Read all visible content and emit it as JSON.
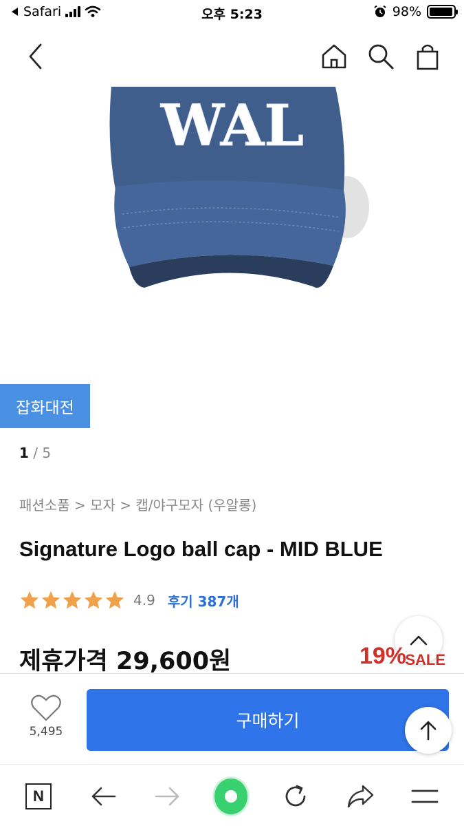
{
  "status_bar": {
    "carrier": "Safari",
    "time": "오후 5:23",
    "battery": "98%",
    "battery_level": 0.98
  },
  "nav": {
    "back_icon": "chevron-left-icon",
    "home_icon": "home-icon",
    "search_icon": "search-icon",
    "cart_icon": "shopping-bag-icon"
  },
  "product": {
    "category_badge": "잡화대전",
    "pager_current": "1",
    "pager_total": "/ 5",
    "breadcrumb": "패션소품 > 모자 > 캡/야구모자 (우알롱)",
    "title": "Signature Logo ball cap - MID BLUE",
    "rating_stars": 5,
    "rating_value": "4.9",
    "review_label": "후기 387개",
    "price_label": "제휴가격 29,600원",
    "discount": "19%",
    "sale_tag": "SALE",
    "cap_logo": "WAL"
  },
  "purchase_bar": {
    "like_count": "5,495",
    "buy_label": "구매하기"
  },
  "colors": {
    "accent_blue": "#2f74e8",
    "badge_blue": "#4a90e2",
    "star_orange": "#f0a14a",
    "discount_red": "#d0302a",
    "cap_navy": "#3f5e8c"
  }
}
